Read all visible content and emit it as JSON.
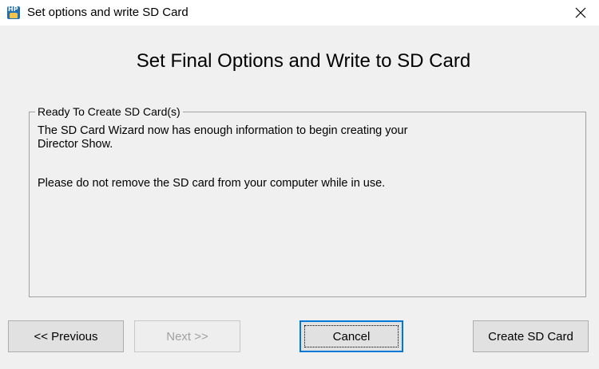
{
  "window": {
    "title": "Set options and write SD Card",
    "close_glyph": "✕"
  },
  "heading": "Set Final Options and Write to SD Card",
  "group": {
    "legend": "Ready To Create SD Card(s)",
    "line1": "The SD Card Wizard now has enough information to begin creating your",
    "line2": "Director Show.",
    "line3": "Please do not remove the SD card from your computer while in use."
  },
  "buttons": {
    "previous": "<< Previous",
    "next": "Next >>",
    "cancel": "Cancel",
    "create": "Create SD Card"
  },
  "icons": {
    "app": "hp-app-icon",
    "app_letters": "HP",
    "close": "close-icon"
  },
  "colors": {
    "window_bg": "#f0f0f0",
    "titlebar_bg": "#ffffff",
    "default_button_border": "#0078d7",
    "disabled_text": "#a0a0a0"
  }
}
